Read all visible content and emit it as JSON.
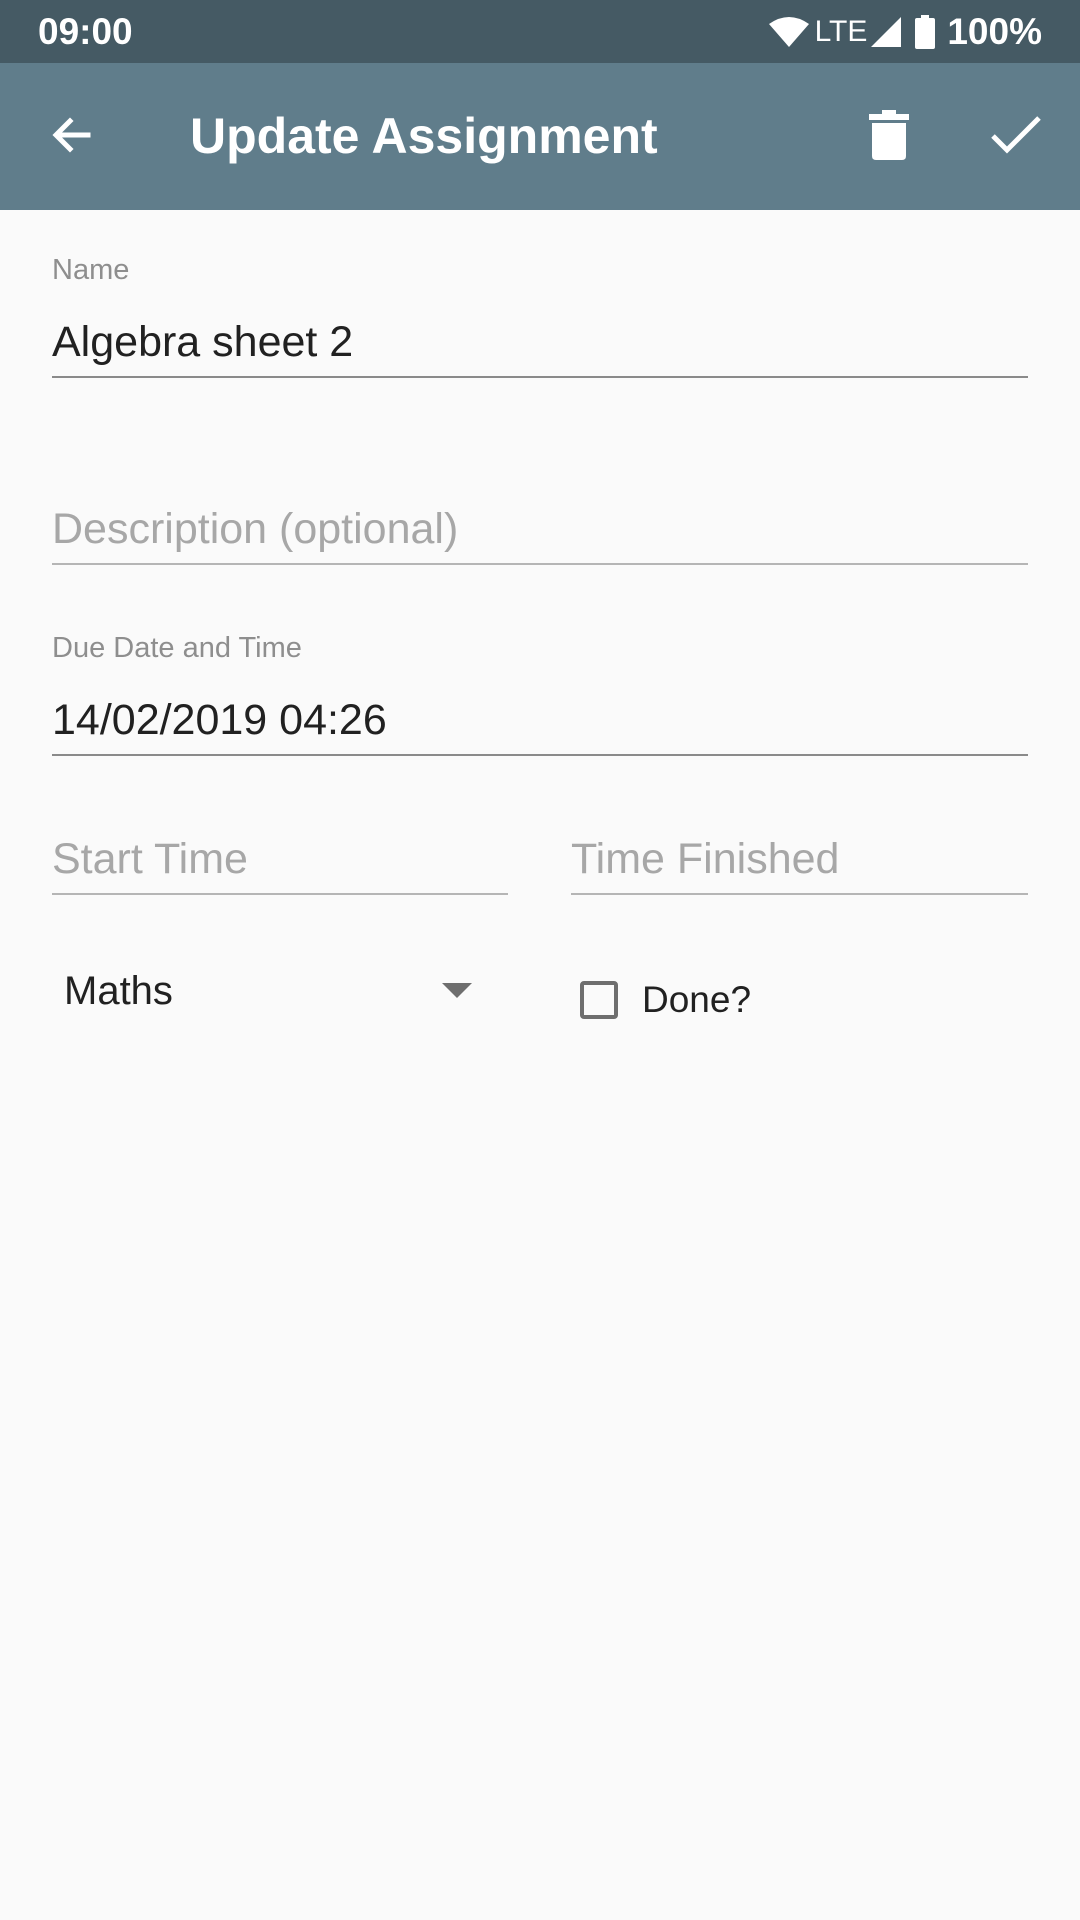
{
  "status_bar": {
    "time": "09:00",
    "network": "LTE",
    "battery": "100%"
  },
  "app_bar": {
    "title": "Update Assignment",
    "icons": [
      "back-arrow-icon",
      "trash-icon",
      "checkmark-icon"
    ]
  },
  "form": {
    "name": {
      "label": "Name",
      "value": "Algebra sheet 2"
    },
    "description": {
      "placeholder": "Description (optional)",
      "value": ""
    },
    "due": {
      "label": "Due Date and Time",
      "value": "14/02/2019 04:26"
    },
    "start_time": {
      "placeholder": "Start Time",
      "value": ""
    },
    "time_finished": {
      "placeholder": "Time Finished",
      "value": ""
    },
    "subject": {
      "selected": "Maths"
    },
    "done": {
      "label": "Done?",
      "checked": false
    }
  },
  "colors": {
    "status_bar": "#455a64",
    "app_bar": "#607d8b",
    "background": "#fafafa"
  }
}
